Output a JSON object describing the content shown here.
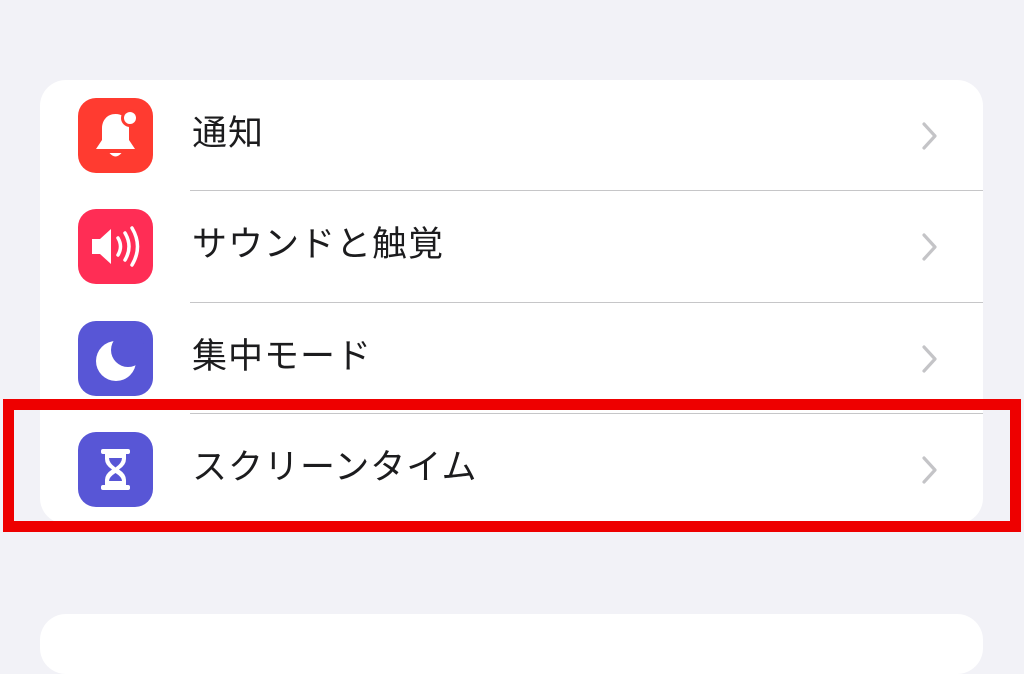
{
  "settings_group": {
    "items": [
      {
        "label": "通知",
        "icon": "bell-badge-icon",
        "icon_color": "#ff3b30"
      },
      {
        "label": "サウンドと触覚",
        "icon": "speaker-wave-icon",
        "icon_color": "#ff2d55"
      },
      {
        "label": "集中モード",
        "icon": "moon-icon",
        "icon_color": "#5856d6"
      },
      {
        "label": "スクリーンタイム",
        "icon": "hourglass-icon",
        "icon_color": "#5856d6"
      }
    ]
  },
  "highlight": {
    "color": "#ee0000",
    "target": "スクリーンタイム"
  },
  "colors": {
    "background": "#f2f2f7",
    "cell": "#ffffff",
    "chevron": "#c4c4c7",
    "separator": "#c6c6c8"
  }
}
